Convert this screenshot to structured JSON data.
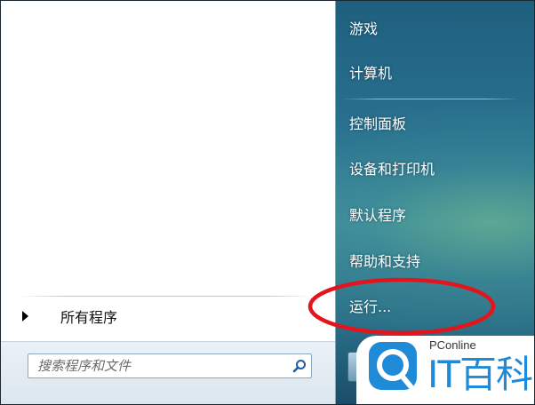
{
  "start_menu": {
    "all_programs_label": "所有程序",
    "search": {
      "placeholder": "搜索程序和文件",
      "value": ""
    },
    "right_items": [
      {
        "label": "游戏"
      },
      {
        "label": "计算机"
      },
      {
        "label": "控制面板"
      },
      {
        "label": "设备和打印机"
      },
      {
        "label": "默认程序"
      },
      {
        "label": "帮助和支持"
      },
      {
        "label": "运行..."
      }
    ],
    "highlighted_item": "运行..."
  },
  "watermark": {
    "brand_small": "PConline",
    "brand_large": "IT百科"
  },
  "colors": {
    "right_pane_top": "#1f5f7e",
    "right_pane_mid": "#3b8a9c",
    "highlight_circle": "#e3141c",
    "watermark_blue": "#1f8ad8"
  },
  "icons": [
    "arrow-right-icon",
    "search-icon",
    "red-highlight-circle",
    "magnifier-logo-icon"
  ]
}
